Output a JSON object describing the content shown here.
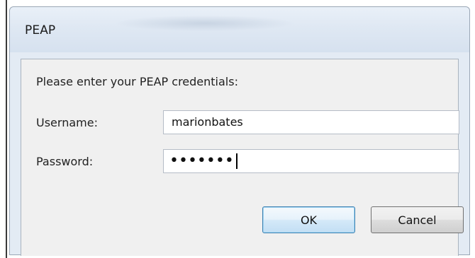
{
  "dialog": {
    "title": "PEAP",
    "prompt": "Please enter your PEAP credentials:",
    "username": {
      "label": "Username:",
      "value": "marionbates"
    },
    "password": {
      "label": "Password:",
      "masked_value": "•••••••"
    },
    "buttons": {
      "ok": "OK",
      "cancel": "Cancel"
    }
  }
}
